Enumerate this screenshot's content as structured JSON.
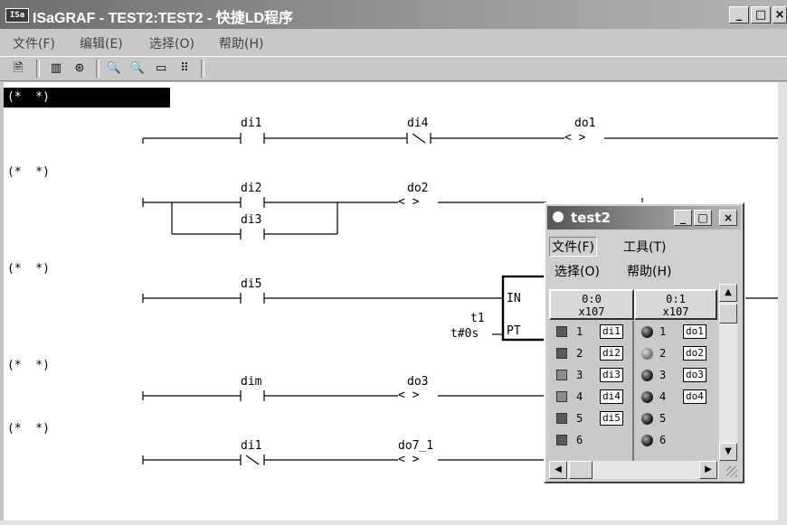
{
  "window": {
    "icon_text": "ISa",
    "title": "ISaGRAF - TEST2:TEST2 - 快捷LD程序",
    "min": "_",
    "max": "□",
    "close": "×"
  },
  "menu": [
    "文件(F)",
    "编辑(E)",
    "选择(O)",
    "帮助(H)"
  ],
  "toolbar_icons": [
    "document-icon",
    "columns-icon",
    "connect-icon",
    "zoom-out-icon",
    "zoom-in-icon",
    "fit-icon",
    "grid-icon"
  ],
  "toolbar_glyphs": [
    "🗎",
    "▥",
    "⊛",
    "🔍",
    "🔍",
    "▭",
    "⠿"
  ],
  "rungs": [
    {
      "comment": "(*  *)",
      "contacts": [
        "di1",
        "di4"
      ],
      "coil": "do1"
    },
    {
      "comment": "(*  *)",
      "contacts": [
        "di2",
        "di3"
      ],
      "coil": "do2"
    },
    {
      "comment": "(*  *)",
      "contacts": [
        "di5"
      ],
      "timer_in": "IN",
      "timer_pt": "PT",
      "timer_name": "t1",
      "timer_preset": "t#0s"
    },
    {
      "comment": "(*  *)",
      "contacts": [
        "dim"
      ],
      "coil": "do3"
    },
    {
      "comment": "(*  *)",
      "contacts": [
        "di1"
      ],
      "coil": "do7_1"
    }
  ],
  "ld_symbols": {
    "no_contact": "⊣ ⊢",
    "nc_contact": "⊣\\⊢",
    "coil": "< >"
  },
  "test2": {
    "title": "test2",
    "min": "_",
    "max": "□",
    "close": "×",
    "menu_row1": [
      "文件(F)",
      "工具(T)"
    ],
    "menu_row2": [
      "选择(O)",
      "帮助(H)"
    ],
    "columns": [
      {
        "addr": "0:0",
        "type": "x107"
      },
      {
        "addr": "0:1",
        "type": "x107"
      }
    ],
    "inputs": [
      {
        "n": "1",
        "tag": "di1"
      },
      {
        "n": "2",
        "tag": "di2"
      },
      {
        "n": "3",
        "tag": "di3"
      },
      {
        "n": "4",
        "tag": "di4"
      },
      {
        "n": "5",
        "tag": "di5"
      },
      {
        "n": "6",
        "tag": ""
      }
    ],
    "outputs": [
      {
        "n": "1",
        "tag": "do1"
      },
      {
        "n": "2",
        "tag": "do2"
      },
      {
        "n": "3",
        "tag": "do3"
      },
      {
        "n": "4",
        "tag": "do4"
      },
      {
        "n": "5",
        "tag": ""
      },
      {
        "n": "6",
        "tag": ""
      }
    ],
    "scroll_up": "▲",
    "scroll_down": "▼",
    "scroll_left": "◀",
    "scroll_right": "▶"
  },
  "colors": {
    "title_dark": "#6e6e6e",
    "face": "#c8c8c8",
    "editor_bg": "#ffffff"
  }
}
